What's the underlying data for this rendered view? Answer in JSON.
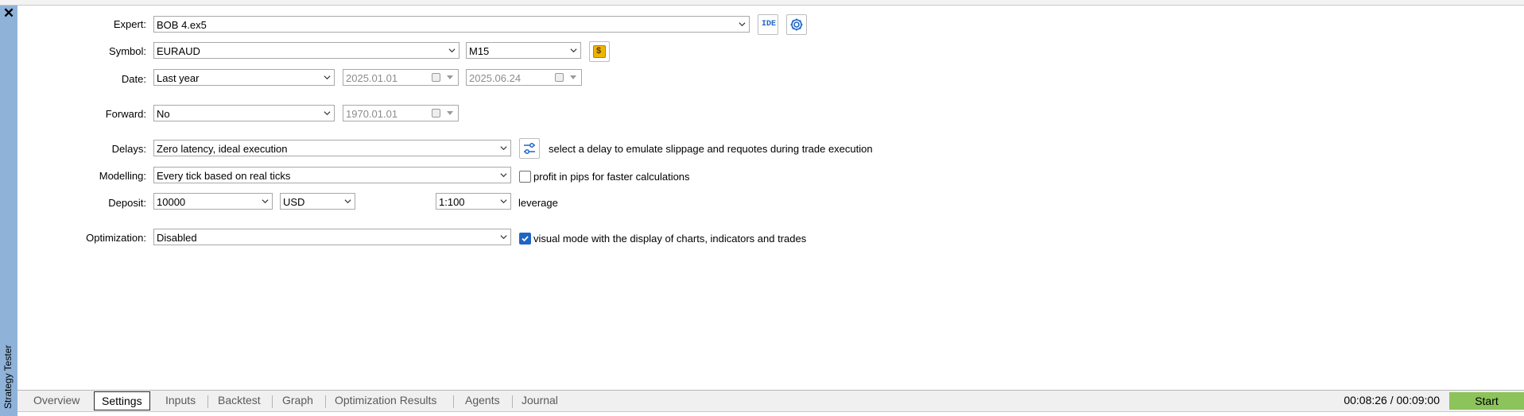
{
  "sidebar": {
    "close_label": "✕",
    "title": "Strategy Tester"
  },
  "form": {
    "expert": {
      "label": "Expert:",
      "value": "BOB 4.ex5",
      "ide_label": "IDE"
    },
    "symbol": {
      "label": "Symbol:",
      "value": "EURAUD",
      "timeframe": "M15",
      "symbol_icon": "$"
    },
    "date": {
      "label": "Date:",
      "range": "Last year",
      "from": "2025.01.01",
      "to": "2025.06.24"
    },
    "forward": {
      "label": "Forward:",
      "value": "No",
      "date": "1970.01.01"
    },
    "delays": {
      "label": "Delays:",
      "value": "Zero latency, ideal execution",
      "hint": "select a delay to emulate slippage and requotes during trade execution"
    },
    "modelling": {
      "label": "Modelling:",
      "value": "Every tick based on real ticks",
      "checkbox_label": "profit in pips for faster calculations",
      "checked": false
    },
    "deposit": {
      "label": "Deposit:",
      "amount": "10000",
      "currency": "USD",
      "leverage_value": "1:100",
      "leverage_label": "leverage"
    },
    "optimization": {
      "label": "Optimization:",
      "value": "Disabled",
      "checkbox_label": "visual mode with the display of charts, indicators and trades",
      "checked": true
    }
  },
  "tabs": [
    {
      "label": "Overview"
    },
    {
      "label": "Settings",
      "active": true
    },
    {
      "label": "Inputs"
    },
    {
      "label": "Backtest"
    },
    {
      "label": "Graph"
    },
    {
      "label": "Optimization Results"
    },
    {
      "label": "Agents"
    },
    {
      "label": "Journal"
    }
  ],
  "status": {
    "timer": "00:08:26 / 00:09:00",
    "start_label": "Start"
  },
  "colors": {
    "sidebar": "#8fb2d9",
    "accent": "#1f66c4",
    "start": "#8cc35a",
    "symbol_icon_bg": "#f0b400"
  }
}
